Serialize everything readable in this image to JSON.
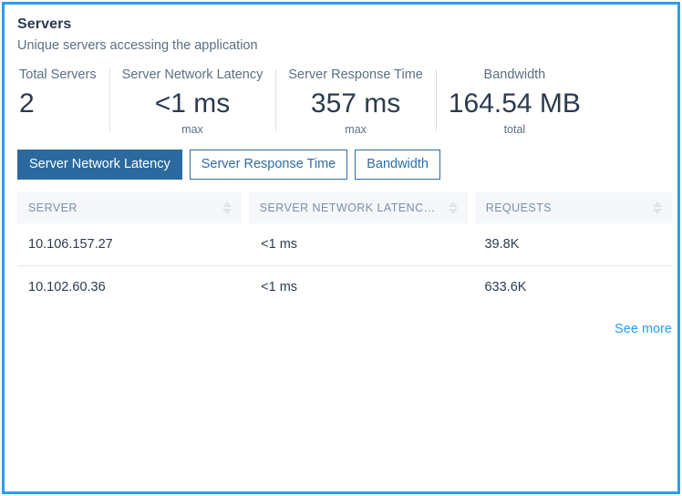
{
  "card": {
    "title": "Servers",
    "subtitle": "Unique servers accessing the application",
    "accent_color": "#2b9df4",
    "border_color": "#2b9df4"
  },
  "stats": [
    {
      "label": "Total Servers",
      "value": "2",
      "sub": ""
    },
    {
      "label": "Server Network Latency",
      "value": "<1 ms",
      "sub": "max"
    },
    {
      "label": "Server Response Time",
      "value": "357 ms",
      "sub": "max"
    },
    {
      "label": "Bandwidth",
      "value": "164.54 MB",
      "sub": "total"
    }
  ],
  "tabs": [
    {
      "label": "Server Network Latency",
      "active": true
    },
    {
      "label": "Server Response Time",
      "active": false
    },
    {
      "label": "Bandwidth",
      "active": false
    }
  ],
  "table": {
    "columns": [
      {
        "label": "SERVER",
        "sort_icon": "sort-both-icon"
      },
      {
        "label": "SERVER NETWORK LATENCY (...",
        "sort_icon": "sort-both-icon"
      },
      {
        "label": "REQUESTS",
        "sort_icon": "sort-both-icon"
      }
    ],
    "rows": [
      {
        "server": "10.106.157.27",
        "latency": "<1 ms",
        "requests": "39.8K"
      },
      {
        "server": "10.102.60.36",
        "latency": "<1 ms",
        "requests": "633.6K"
      }
    ]
  },
  "footer": {
    "see_more_label": "See more"
  }
}
